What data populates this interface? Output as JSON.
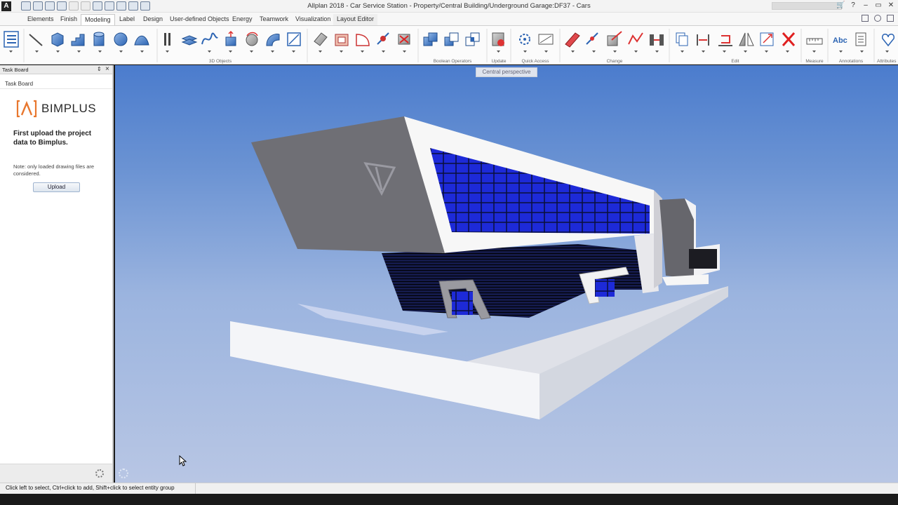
{
  "window": {
    "title": "Allplan 2018 - Car Service Station - Property/Central Building/Underground Garage:DF37 - Cars",
    "app_logo": "A"
  },
  "ribbon": {
    "tabs": [
      {
        "label": "Elements"
      },
      {
        "label": "Finish"
      },
      {
        "label": "Modeling",
        "active": true
      },
      {
        "label": "Label"
      },
      {
        "label": "Design"
      },
      {
        "label": "User-defined Objects"
      },
      {
        "label": "Energy"
      },
      {
        "label": "Teamwork"
      },
      {
        "label": "Visualization"
      },
      {
        "label": "Layout Editor"
      }
    ],
    "groups": [
      {
        "label": "3D Objects"
      },
      {
        "label": "Boolean Operators"
      },
      {
        "label": "Update"
      },
      {
        "label": "Quick Access"
      },
      {
        "label": "Change"
      },
      {
        "label": "Edit"
      },
      {
        "label": "Measure"
      },
      {
        "label": "Annotations"
      },
      {
        "label": "Attributes"
      }
    ],
    "annotation_tool_text": "Abc"
  },
  "task_board": {
    "header": "Task Board",
    "subtitle": "Task Board",
    "logo_text": "BIMPLUS",
    "heading": "First upload the project data to Bimplus.",
    "note": "Note: only loaded drawing files are considered.",
    "upload_button": "Upload"
  },
  "viewport": {
    "view_label": "Central perspective",
    "background_top": "#4b7ccd",
    "background_bottom": "#b8c6e4"
  },
  "status_bar": {
    "text": "Click left to select, Ctrl+click to add, Shift+click to select entity group"
  },
  "colors": {
    "accent_orange": "#e8772e",
    "glass_blue": "#1d2ad8"
  }
}
